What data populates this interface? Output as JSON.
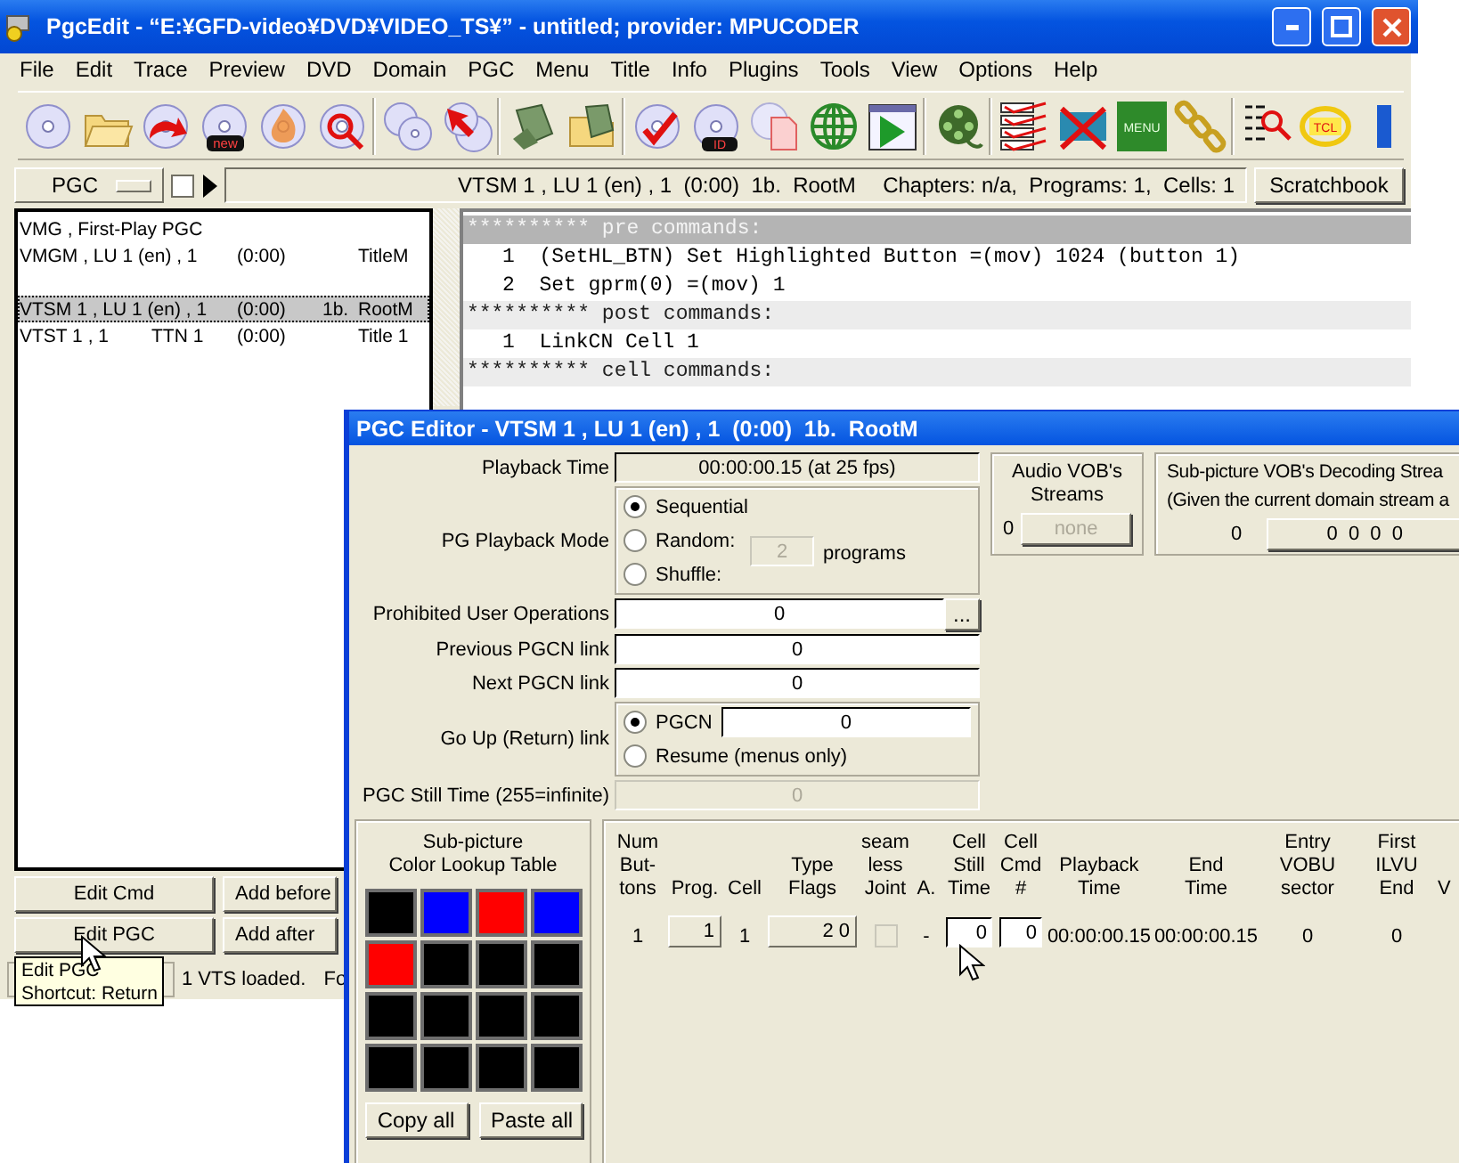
{
  "main_window": {
    "title": "PgcEdit - “E:¥GFD-video¥DVD¥VIDEO_TS¥” - untitled; provider: MPUCODER",
    "menu": [
      "File",
      "Edit",
      "Trace",
      "Preview",
      "DVD",
      "Domain",
      "PGC",
      "Menu",
      "Title",
      "Info",
      "Plugins",
      "Tools",
      "View",
      "Options",
      "Help"
    ],
    "toolbar": {
      "badges": [
        "new",
        "ID",
        "MENU",
        "TCL"
      ]
    },
    "domain_selector": {
      "value": "PGC"
    },
    "trace_checkbox": {
      "checked": false
    },
    "current_pgc": "VTSM 1 , LU 1 (en) , 1  (0:00)  1b.  RootM",
    "counts": "Chapters: n/a,  Programs: 1,  Cells: 1",
    "scratchbook_button": "Scratchbook",
    "pgc_list": [
      {
        "kind": "entry",
        "pgc": "VMG , First-Play PGC",
        "selected": false
      },
      {
        "kind": "entry",
        "pgc": "VMGM , LU 1 (en) , 1",
        "time": "(0:00)",
        "label": "TitleM",
        "selected": false
      },
      {
        "kind": "gap"
      },
      {
        "kind": "entry",
        "pgc": "VTSM 1 , LU 1 (en) , 1",
        "time": "(0:00)",
        "button": "1b.",
        "label": "RootM",
        "selected": true
      },
      {
        "kind": "entry",
        "pgc": "VTST 1 , 1",
        "title_number": "TTN 1",
        "time": "(0:00)",
        "label": "Title 1",
        "selected": false
      }
    ],
    "commands": [
      {
        "kind": "header",
        "text": "********** pre commands:",
        "selected": true
      },
      {
        "kind": "command",
        "number": "1",
        "text": "(SetHL_BTN) Set Highlighted Button =(mov) 1024 (button 1)"
      },
      {
        "kind": "command",
        "number": "2",
        "text": "Set gprm(0) =(mov) 1"
      },
      {
        "kind": "header",
        "text": "********** post commands:",
        "selected": false
      },
      {
        "kind": "command",
        "number": "1",
        "text": "LinkCN Cell 1"
      },
      {
        "kind": "header",
        "text": "********** cell commands:",
        "selected": false
      }
    ],
    "buttons": [
      "Edit Cmd",
      "Add before",
      "Edit PGC",
      "Add after"
    ],
    "status": [
      "1 VTS loaded.",
      "Fo"
    ],
    "tooltip": {
      "title": "Edit PGC",
      "shortcut": "Shortcut: Return"
    }
  },
  "pgc_editor": {
    "title": "PGC Editor - VTSM 1 , LU 1 (en) , 1  (0:00)  1b.  RootM",
    "playback_time": {
      "label": "Playback Time",
      "value": "00:00:00.15 (at 25 fps)"
    },
    "playback_mode": {
      "label": "PG Playback Mode",
      "options": [
        {
          "label": "Sequential",
          "selected": true
        },
        {
          "label": "Random:",
          "selected": false
        },
        {
          "label": "Shuffle:",
          "selected": false
        }
      ],
      "programs": {
        "value": "2",
        "disabled": true
      },
      "unit": "programs"
    },
    "prohibited_ops": {
      "label": "Prohibited User Operations",
      "value": "0",
      "button": "..."
    },
    "previous_link": {
      "label": "Previous PGCN link",
      "value": "0"
    },
    "next_link": {
      "label": "Next PGCN link",
      "value": "0"
    },
    "go_up_link": {
      "label": "Go Up (Return) link",
      "options": [
        {
          "label": "PGCN",
          "selected": true,
          "value": "0"
        },
        {
          "label": "Resume (menus only)",
          "selected": false
        }
      ]
    },
    "still_time": {
      "label": "PGC Still Time (255=infinite)",
      "value": "0",
      "disabled": true
    },
    "audio_streams": {
      "title": "Audio VOB's\nStreams",
      "count": "0",
      "button": "none",
      "disabled": true
    },
    "subpicture_streams": {
      "title": "Sub-picture VOB's Decoding Strea",
      "subtitle": "(Given the current domain stream a",
      "count": "0",
      "button": "0  0  0  0"
    },
    "clut": {
      "title": "Sub-picture\nColor Lookup Table",
      "colors": [
        {
          "color": "#000000"
        },
        {
          "color": "#0000ff"
        },
        {
          "color": "#ff0000"
        },
        {
          "color": "#0000ff"
        },
        {
          "color": "#ff0000"
        },
        {
          "color": "#000000"
        },
        {
          "color": "#000000"
        },
        {
          "color": "#000000"
        },
        {
          "color": "#000000"
        },
        {
          "color": "#000000"
        },
        {
          "color": "#000000"
        },
        {
          "color": "#000000"
        },
        {
          "color": "#000000"
        },
        {
          "color": "#000000"
        },
        {
          "color": "#000000"
        },
        {
          "color": "#000000"
        }
      ],
      "buttons": [
        "Copy all",
        "Paste all"
      ]
    },
    "cells_table": {
      "columns": [
        {
          "label": "Num\nBut-\ntons",
          "kind": "text"
        },
        {
          "label": "Prog.",
          "kind": "button"
        },
        {
          "label": "Cell",
          "kind": "text"
        },
        {
          "label": "Type\nFlags",
          "kind": "flags"
        },
        {
          "label": "seam\nless\nJoint",
          "kind": "checkbox"
        },
        {
          "label": "A.",
          "kind": "text"
        },
        {
          "label": "Cell\nStill\nTime",
          "kind": "field"
        },
        {
          "label": "Cell\nCmd\n#",
          "kind": "field"
        },
        {
          "label": "Playback\nTime",
          "kind": "text"
        },
        {
          "label": "End\nTime",
          "kind": "text"
        },
        {
          "label": "Entry\nVOBU\nsector",
          "kind": "text"
        },
        {
          "label": "First\nILVU\nEnd",
          "kind": "text"
        },
        {
          "label": "V",
          "kind": "text"
        }
      ],
      "rows": [
        {
          "cells": [
            "1",
            "1",
            "1",
            [
              "2",
              "0"
            ],
            {
              "checked": false,
              "disabled": true
            },
            "-",
            "0",
            "0",
            "00:00:00.15",
            "00:00:00.15",
            "0",
            "0"
          ]
        }
      ]
    }
  }
}
